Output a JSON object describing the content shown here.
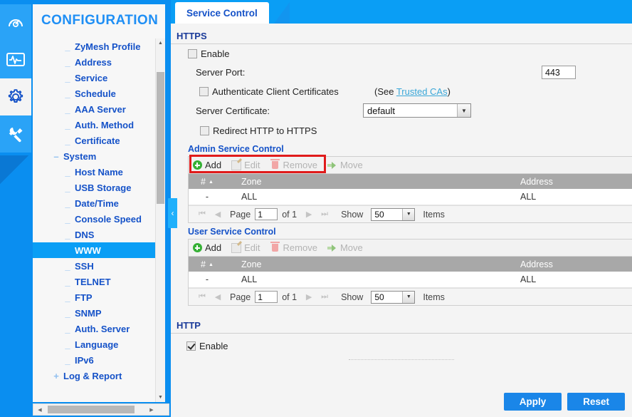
{
  "rail": {
    "items": [
      {
        "name": "dashboard-icon",
        "label": "Dashboard"
      },
      {
        "name": "monitor-icon",
        "label": "Monitor"
      },
      {
        "name": "configuration-icon",
        "label": "Configuration"
      },
      {
        "name": "maintenance-icon",
        "label": "Maintenance"
      }
    ]
  },
  "sidebar": {
    "title": "CONFIGURATION",
    "items": [
      {
        "label": "ZyMesh Profile",
        "level": 2,
        "marker": "_",
        "selected": false
      },
      {
        "label": "Address",
        "level": 2,
        "marker": "_",
        "selected": false
      },
      {
        "label": "Service",
        "level": 2,
        "marker": "_",
        "selected": false
      },
      {
        "label": "Schedule",
        "level": 2,
        "marker": "_",
        "selected": false
      },
      {
        "label": "AAA Server",
        "level": 2,
        "marker": "_",
        "selected": false
      },
      {
        "label": "Auth. Method",
        "level": 2,
        "marker": "_",
        "selected": false
      },
      {
        "label": "Certificate",
        "level": 2,
        "marker": "_",
        "selected": false
      },
      {
        "label": "System",
        "level": 1,
        "marker": "–",
        "selected": false
      },
      {
        "label": "Host Name",
        "level": 2,
        "marker": "_",
        "selected": false
      },
      {
        "label": "USB Storage",
        "level": 2,
        "marker": "_",
        "selected": false
      },
      {
        "label": "Date/Time",
        "level": 2,
        "marker": "_",
        "selected": false
      },
      {
        "label": "Console Speed",
        "level": 2,
        "marker": "_",
        "selected": false
      },
      {
        "label": "DNS",
        "level": 2,
        "marker": "_",
        "selected": false
      },
      {
        "label": "WWW",
        "level": 2,
        "marker": "",
        "selected": true
      },
      {
        "label": "SSH",
        "level": 2,
        "marker": "_",
        "selected": false
      },
      {
        "label": "TELNET",
        "level": 2,
        "marker": "_",
        "selected": false
      },
      {
        "label": "FTP",
        "level": 2,
        "marker": "_",
        "selected": false
      },
      {
        "label": "SNMP",
        "level": 2,
        "marker": "_",
        "selected": false
      },
      {
        "label": "Auth. Server",
        "level": 2,
        "marker": "_",
        "selected": false
      },
      {
        "label": "Language",
        "level": 2,
        "marker": "_",
        "selected": false
      },
      {
        "label": "IPv6",
        "level": 2,
        "marker": "_",
        "selected": false
      },
      {
        "label": "Log & Report",
        "level": 1,
        "marker": "+",
        "selected": false
      }
    ],
    "collapse_handle": "‹"
  },
  "tabs": [
    {
      "label": "Service Control",
      "active": true
    }
  ],
  "https": {
    "section_title": "HTTPS",
    "enable_label": "Enable",
    "enable_checked": false,
    "server_port_label": "Server Port:",
    "server_port_value": "443",
    "auth_client_cert_label": "Authenticate Client Certificates",
    "auth_client_cert_checked": false,
    "see_prefix": "(See ",
    "trusted_cas_link": "Trusted CAs",
    "see_suffix": ")",
    "server_cert_label": "Server Certificate:",
    "server_cert_value": "default",
    "redirect_label": "Redirect HTTP to HTTPS",
    "redirect_checked": false,
    "highlight_color": "#e01b1b"
  },
  "admin_table": {
    "title": "Admin Service Control",
    "toolbar": [
      {
        "label": "Add",
        "icon": "plus-circle-icon",
        "enabled": true
      },
      {
        "label": "Edit",
        "icon": "pencil-icon",
        "enabled": false
      },
      {
        "label": "Remove",
        "icon": "trash-icon",
        "enabled": false
      },
      {
        "label": "Move",
        "icon": "move-arrow-icon",
        "enabled": false
      }
    ],
    "columns": [
      "#",
      "Zone",
      "Address"
    ],
    "sort_caret": "▲",
    "rows": [
      {
        "num": "-",
        "zone": "ALL",
        "address": "ALL"
      }
    ],
    "pager": {
      "first": "⏮",
      "prev": "◀",
      "next": "▶",
      "last": "⏭",
      "page_label": "Page",
      "page_value": "1",
      "of_label": "of 1",
      "show_label": "Show",
      "show_value": "50",
      "items_label": "Items"
    }
  },
  "user_table": {
    "title": "User Service Control",
    "toolbar": [
      {
        "label": "Add",
        "icon": "plus-circle-icon",
        "enabled": true
      },
      {
        "label": "Edit",
        "icon": "pencil-icon",
        "enabled": false
      },
      {
        "label": "Remove",
        "icon": "trash-icon",
        "enabled": false
      },
      {
        "label": "Move",
        "icon": "move-arrow-icon",
        "enabled": false
      }
    ],
    "columns": [
      "#",
      "Zone",
      "Address"
    ],
    "sort_caret": "▲",
    "rows": [
      {
        "num": "-",
        "zone": "ALL",
        "address": "ALL"
      }
    ],
    "pager": {
      "first": "⏮",
      "prev": "◀",
      "next": "▶",
      "last": "⏭",
      "page_label": "Page",
      "page_value": "1",
      "of_label": "of 1",
      "show_label": "Show",
      "show_value": "50",
      "items_label": "Items"
    }
  },
  "http": {
    "section_title": "HTTP",
    "enable_label": "Enable",
    "enable_checked": true
  },
  "footer": {
    "apply_label": "Apply",
    "reset_label": "Reset"
  },
  "theme": {
    "brand_blue": "#0a9ef5",
    "nav_text": "#1552c8",
    "selected_bg": "#0a9ef5",
    "button_blue": "#1a86e8",
    "link_blue": "#3aa7d8"
  }
}
